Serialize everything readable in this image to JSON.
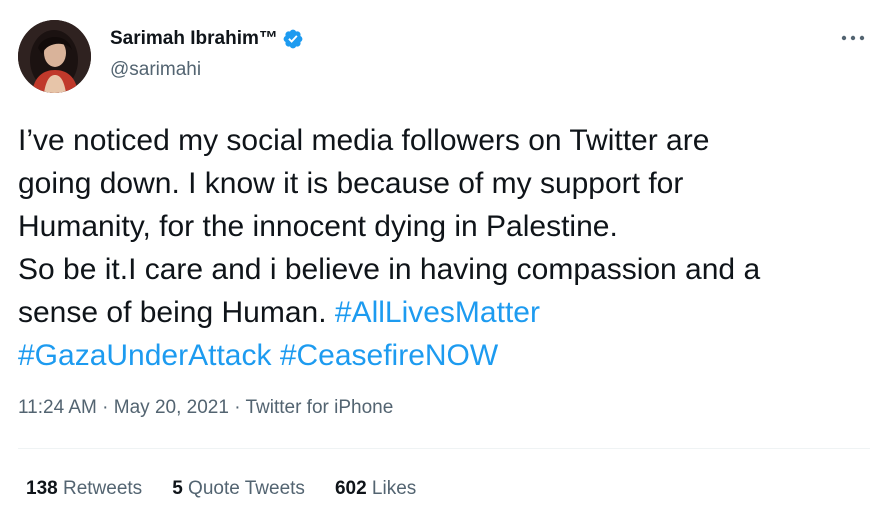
{
  "author": {
    "display_name": "Sarimah Ibrahim™",
    "handle": "@sarimahi",
    "verified": true,
    "avatar_icon": "profile-photo"
  },
  "tweet": {
    "lines": [
      [
        {
          "text": "I’ve noticed my social media followers on Twitter are",
          "type": "text"
        }
      ],
      [
        {
          "text": "going down. I know it is because of my support for",
          "type": "text"
        }
      ],
      [
        {
          "text": "Humanity, for the innocent dying in Palestine.",
          "type": "text"
        }
      ],
      [
        {
          "text": "So be it.I care and i believe in having compassion and a",
          "type": "text"
        }
      ],
      [
        {
          "text": "sense of being Human. ",
          "type": "text"
        },
        {
          "text": "#AllLivesMatter",
          "type": "hashtag"
        }
      ],
      [
        {
          "text": "#GazaUnderAttack",
          "type": "hashtag"
        },
        {
          "text": " ",
          "type": "text"
        },
        {
          "text": "#CeasefireNOW",
          "type": "hashtag"
        }
      ]
    ]
  },
  "meta": {
    "time": "11:24 AM",
    "separator": "·",
    "date": "May 20, 2021",
    "source": "Twitter for iPhone"
  },
  "stats": {
    "retweets": {
      "count": "138",
      "label": "Retweets"
    },
    "quote_tweets": {
      "count": "5",
      "label": "Quote Tweets"
    },
    "likes": {
      "count": "602",
      "label": "Likes"
    }
  },
  "colors": {
    "accent": "#1d9bf0",
    "text": "#0f1419",
    "secondary": "#536471"
  },
  "icons": {
    "verified": "verified-badge-icon",
    "more": "more-options-icon"
  }
}
